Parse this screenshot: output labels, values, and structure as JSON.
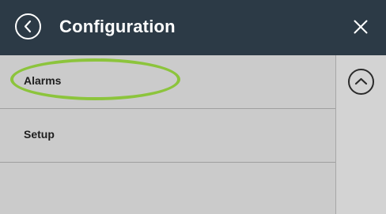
{
  "header": {
    "title": "Configuration",
    "back_icon": "chevron-left-icon",
    "close_icon": "close-icon"
  },
  "menu": {
    "items": [
      {
        "label": "Alarms",
        "highlighted": true
      },
      {
        "label": "Setup",
        "highlighted": false
      }
    ]
  },
  "scroll": {
    "up_icon": "chevron-up-icon"
  },
  "colors": {
    "titlebar_bg": "#2c3a46",
    "menu_bg": "#cbcbcb",
    "highlight_ring": "#8cc43c"
  }
}
